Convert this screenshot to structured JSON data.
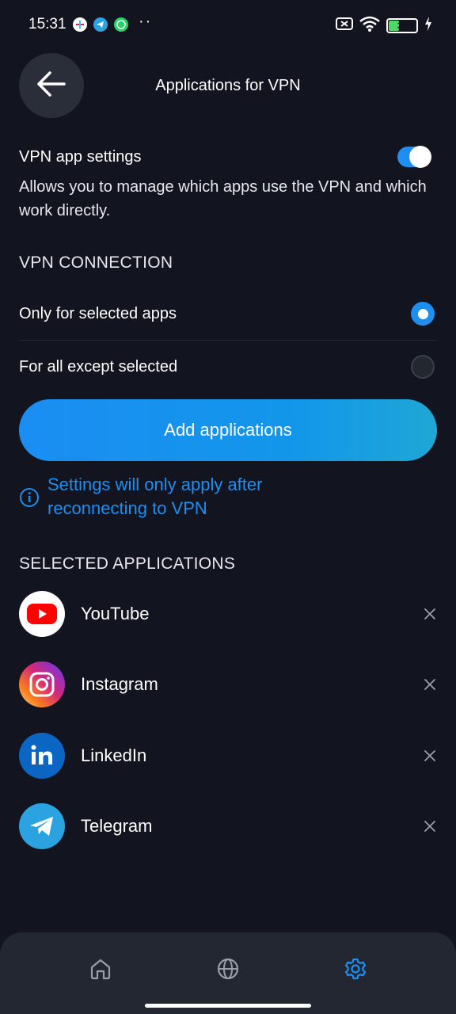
{
  "status_bar": {
    "time": "15:31",
    "dots": "··",
    "battery": "37",
    "icons": [
      "slack-icon",
      "telegram-icon",
      "whatsapp-icon",
      "sim-off-icon",
      "wifi-icon",
      "battery-icon",
      "charging-icon"
    ]
  },
  "header": {
    "title": "Applications for VPN",
    "back_icon": "arrow-left-icon"
  },
  "settings": {
    "title": "VPN app settings",
    "description": "Allows you to manage which apps use the VPN and which work directly.",
    "enabled": true
  },
  "connection": {
    "section_label": "VPN CONNECTION",
    "options": [
      {
        "label": "Only for selected apps",
        "selected": true
      },
      {
        "label": "For all except selected",
        "selected": false
      }
    ]
  },
  "add_button": {
    "label": "Add applications"
  },
  "info": {
    "icon": "info-icon",
    "text": "Settings will only apply after reconnecting to VPN"
  },
  "selected_apps": {
    "section_label": "SELECTED APPLICATIONS",
    "items": [
      {
        "name": "YouTube",
        "icon": "youtube-icon"
      },
      {
        "name": "Instagram",
        "icon": "instagram-icon"
      },
      {
        "name": "LinkedIn",
        "icon": "linkedin-icon"
      },
      {
        "name": "Telegram",
        "icon": "telegram-icon"
      }
    ]
  },
  "bottom_nav": {
    "items": [
      {
        "icon": "home-icon",
        "active": false
      },
      {
        "icon": "globe-icon",
        "active": false
      },
      {
        "icon": "settings-gear-icon",
        "active": true
      }
    ]
  },
  "colors": {
    "background": "#12151f",
    "accent": "#1e8ff0",
    "nav_background": "#232731"
  }
}
